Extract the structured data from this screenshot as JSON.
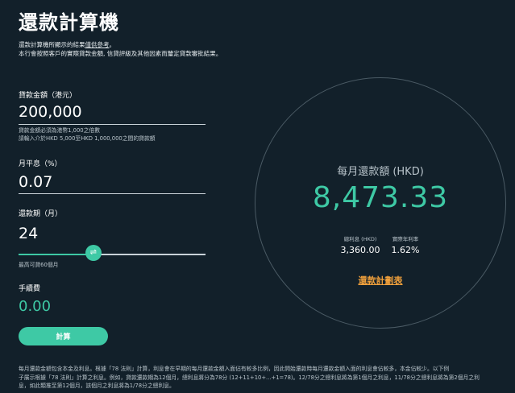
{
  "header": {
    "title": "還款計算機",
    "intro_line1_pre": "還款計算機所顯示的結果",
    "intro_line1_hl": "僅供參考",
    "intro_line1_post": "。",
    "intro_line2": "本行會按照客戶的實際貸款金額, 信貸評級及其他因素而釐定貸款審批結果。"
  },
  "loan_amount": {
    "label": "貸款金額（港元）",
    "value": "200,000",
    "hint_line1": "貸款金額必須為港幣1,000之倍數",
    "hint_line2": "請輸入介於HKD 5,000至HKD 1,000,000之間的貸款額"
  },
  "monthly_rate": {
    "label": "月平息（%）",
    "value": "0.07"
  },
  "tenor": {
    "label": "還款期（月）",
    "value": "24",
    "slider_level": 0.4,
    "knob_glyph": "⇌",
    "hint": "最高可貸60個月"
  },
  "fee": {
    "label": "手續費",
    "value": "0.00"
  },
  "calculate_button": "計算",
  "result": {
    "monthly_label": "每月還款額 (HKD)",
    "monthly_value": "8,473.33",
    "interest_label": "總利息 (HKD)",
    "interest_value": "3,360.00",
    "apr_label": "實際年利率",
    "apr_value": "1.62%",
    "schedule_link": "還款計劃表"
  },
  "footnote": {
    "line1": "每月還款金額包含本金及利息。根據「78 法則」計算，利息會在早期的每月還款金額入面佔有較多比例，因此開始還款時每月還款金額入面的利息會佔較多，本金佔較少。以下例",
    "line2": "子展示根據「78 法則」計算之利息。例如，貸款還款期為12個月，總利息將分為78分 (12+11+10+...+1=78)。12/78分之總利息將為第1個月之利息，11/78分之總利息將為第2個月之利",
    "line3": "息，如此類推至第12個月，該個月之利息將為1/78分之總利息。"
  },
  "colors": {
    "background": "#12202a",
    "accent": "#3ec9a5",
    "link": "#f0a03c"
  }
}
